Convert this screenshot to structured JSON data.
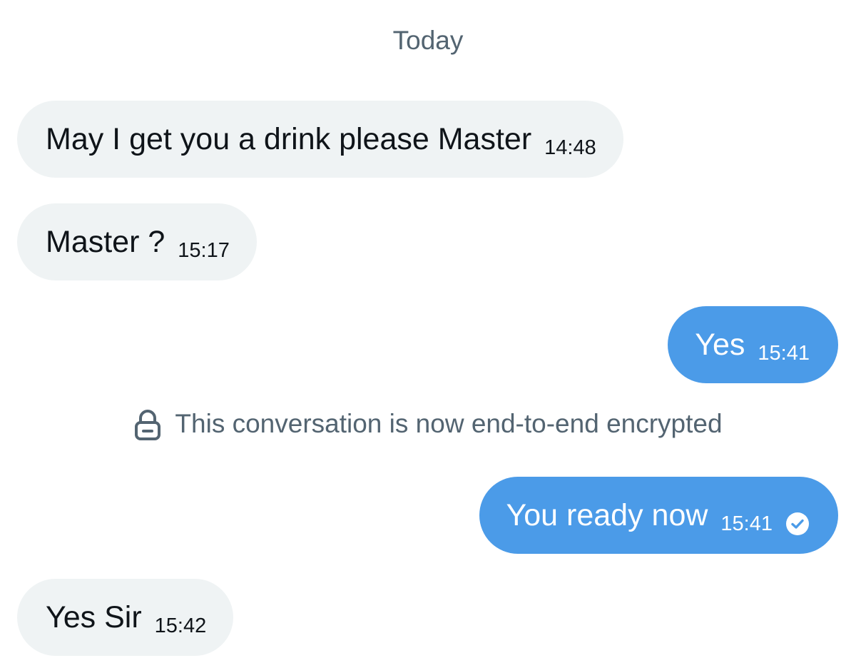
{
  "conversation": {
    "date_divider": "Today",
    "messages": [
      {
        "direction": "incoming",
        "text": "May I get you a drink please Master",
        "time": "14:48"
      },
      {
        "direction": "incoming",
        "text": "Master ?",
        "time": "15:17"
      },
      {
        "direction": "outgoing",
        "text": "Yes",
        "time": "15:41"
      },
      {
        "direction": "outgoing",
        "text": "You ready now",
        "time": "15:41",
        "status_icon": "read-check-icon"
      },
      {
        "direction": "incoming",
        "text": "Yes Sir",
        "time": "15:42"
      }
    ],
    "system_note": {
      "icon": "lock-icon",
      "text": "This conversation is now end-to-end encrypted"
    }
  },
  "colors": {
    "incoming_bubble": "#eff3f4",
    "outgoing_bubble": "#4b9be8",
    "primary_text": "#0f1419",
    "secondary_text": "#536471"
  }
}
